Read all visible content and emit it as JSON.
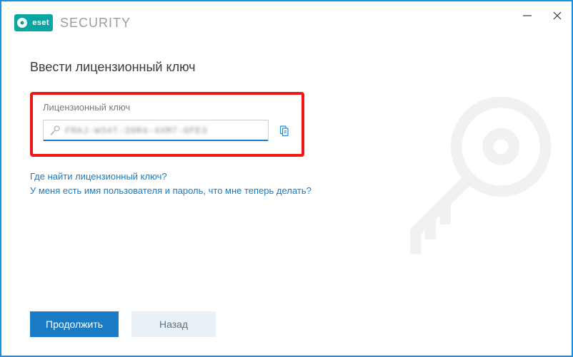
{
  "brand": {
    "logo_label": "eset",
    "product": "SECURITY"
  },
  "page": {
    "title": "Ввести лицензионный ключ"
  },
  "license": {
    "label": "Лицензионный ключ",
    "value": "FRAJ-W34T-39R4-4XM7-GFE3"
  },
  "links": {
    "where": "Где найти лицензионный ключ?",
    "have_creds": "У меня есть имя пользователя и пароль, что мне теперь делать?"
  },
  "buttons": {
    "continue": "Продолжить",
    "back": "Назад"
  }
}
